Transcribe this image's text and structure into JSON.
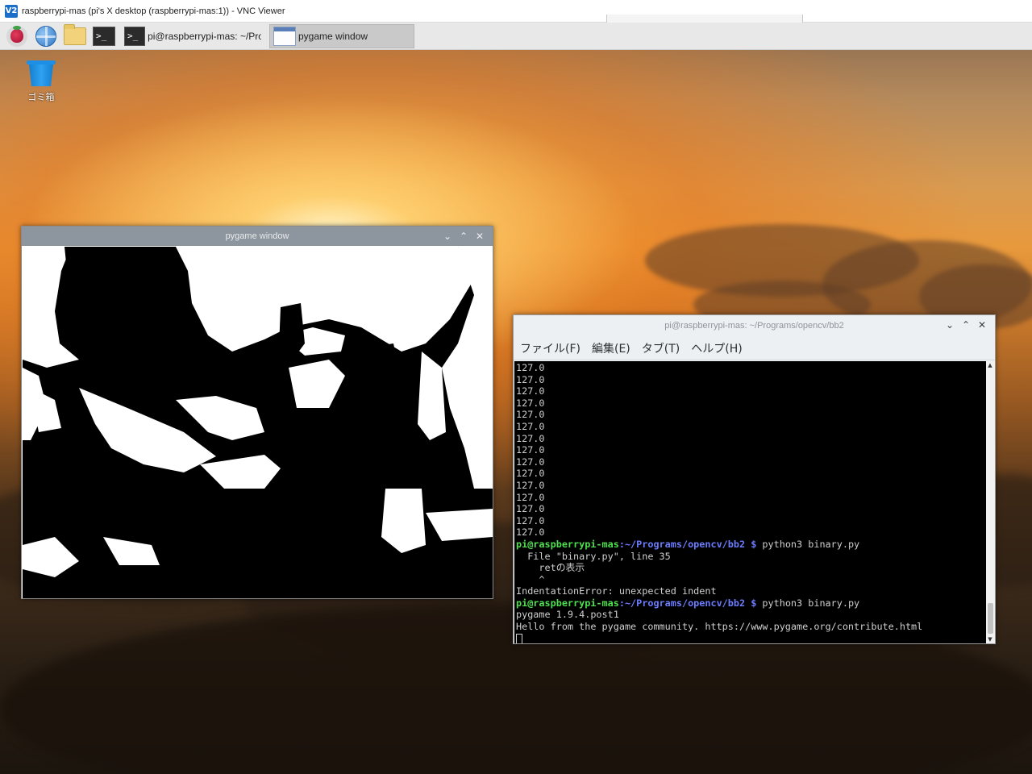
{
  "vnc": {
    "logo_text": "V2",
    "title": "raspberrypi-mas (pi's X desktop (raspberrypi-mas:1)) - VNC Viewer"
  },
  "taskbar": {
    "launchers": [
      {
        "icon": "raspberry-menu-icon"
      },
      {
        "icon": "web-browser-icon"
      },
      {
        "icon": "file-manager-icon"
      },
      {
        "icon": "terminal-icon",
        "glyph": ">_"
      }
    ],
    "tasks": [
      {
        "label": "pi@raspberrypi-mas: ~/Pro...",
        "icon": "terminal-icon",
        "glyph": ">_",
        "active": false
      },
      {
        "label": "pygame window",
        "icon": "window-icon",
        "active": true
      }
    ]
  },
  "desktop": {
    "trash_label": "ゴミ箱"
  },
  "pygame_window": {
    "title": "pygame window",
    "buttons": {
      "minimize": "⌄",
      "maximize": "⌃",
      "close": "✕"
    }
  },
  "terminal_window": {
    "title": "pi@raspberrypi-mas: ~/Programs/opencv/bb2",
    "buttons": {
      "minimize": "⌄",
      "maximize": "⌃",
      "close": "✕"
    },
    "menu": [
      "ファイル(F)",
      "編集(E)",
      "タブ(T)",
      "ヘルプ(H)"
    ],
    "output_lines": [
      {
        "type": "plain",
        "text": "127.0"
      },
      {
        "type": "plain",
        "text": "127.0"
      },
      {
        "type": "plain",
        "text": "127.0"
      },
      {
        "type": "plain",
        "text": "127.0"
      },
      {
        "type": "plain",
        "text": "127.0"
      },
      {
        "type": "plain",
        "text": "127.0"
      },
      {
        "type": "plain",
        "text": "127.0"
      },
      {
        "type": "plain",
        "text": "127.0"
      },
      {
        "type": "plain",
        "text": "127.0"
      },
      {
        "type": "plain",
        "text": "127.0"
      },
      {
        "type": "plain",
        "text": "127.0"
      },
      {
        "type": "plain",
        "text": "127.0"
      },
      {
        "type": "plain",
        "text": "127.0"
      },
      {
        "type": "plain",
        "text": "127.0"
      },
      {
        "type": "plain",
        "text": "127.0"
      },
      {
        "type": "prompt",
        "user": "pi@raspberrypi-mas",
        "path": ":~/Programs/opencv/bb2",
        "dollar": " $ ",
        "cmd": "python3 binary.py"
      },
      {
        "type": "plain",
        "text": "  File \"binary.py\", line 35"
      },
      {
        "type": "plain",
        "text": "    retの表示"
      },
      {
        "type": "plain",
        "text": "    ^"
      },
      {
        "type": "plain",
        "text": "IndentationError: unexpected indent"
      },
      {
        "type": "prompt",
        "user": "pi@raspberrypi-mas",
        "path": ":~/Programs/opencv/bb2",
        "dollar": " $ ",
        "cmd": "python3 binary.py"
      },
      {
        "type": "plain",
        "text": "pygame 1.9.4.post1"
      },
      {
        "type": "plain",
        "text": "Hello from the pygame community. https://www.pygame.org/contribute.html"
      },
      {
        "type": "cursor",
        "text": ""
      }
    ]
  },
  "colors": {
    "prompt_user": "#4ee04e",
    "prompt_path": "#6c7cff",
    "terminal_bg": "#000000",
    "terminal_fg": "#cfcfcf"
  }
}
